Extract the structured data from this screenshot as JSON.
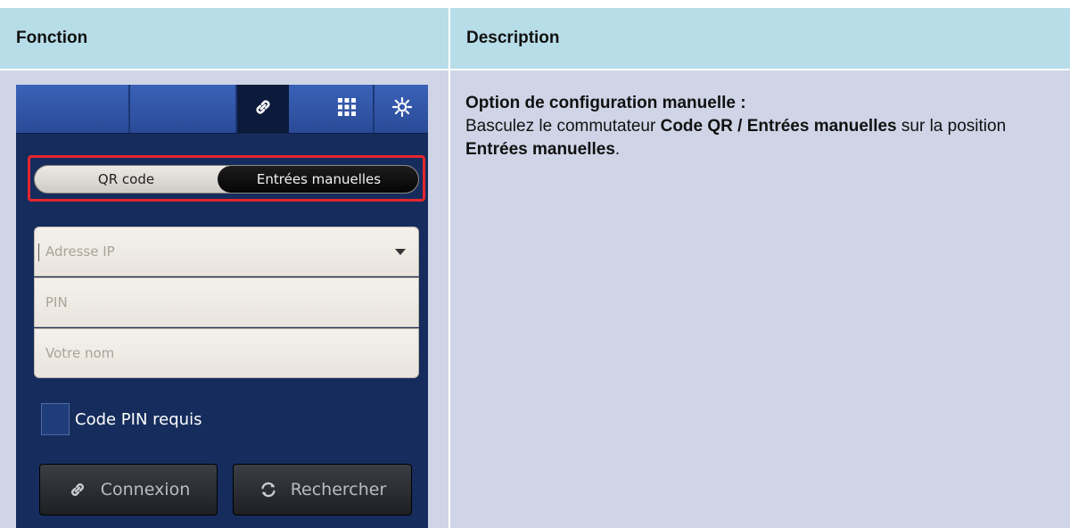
{
  "table": {
    "headers": [
      "Fonction",
      "Description"
    ],
    "colors": {
      "header_bg": "#b7dde8",
      "body_bg": "#cfd5e6",
      "highlight": "#e5262e"
    }
  },
  "phone": {
    "tab_icons": [
      "link-icon",
      "grid-icon",
      "gear-icon"
    ],
    "segment": {
      "left": "QR code",
      "right": "Entrées manuelles",
      "selected": "Entrées manuelles"
    },
    "fields": [
      {
        "placeholder": "Adresse IP",
        "has_dropdown": true
      },
      {
        "placeholder": "PIN"
      },
      {
        "placeholder": "Votre nom"
      }
    ],
    "checkbox": {
      "label": "Code PIN requis",
      "checked": false
    },
    "buttons": [
      {
        "label": "Connexion",
        "icon": "link-icon"
      },
      {
        "label": "Rechercher",
        "icon": "refresh-icon"
      }
    ]
  },
  "description": {
    "title": "Option de configuration manuelle :",
    "text_1": "Basculez le commutateur ",
    "bold_1": "Code QR / Entrées manuelles",
    "text_2": " sur la position ",
    "bold_2": "Entrées manuelles",
    "text_3": "."
  }
}
